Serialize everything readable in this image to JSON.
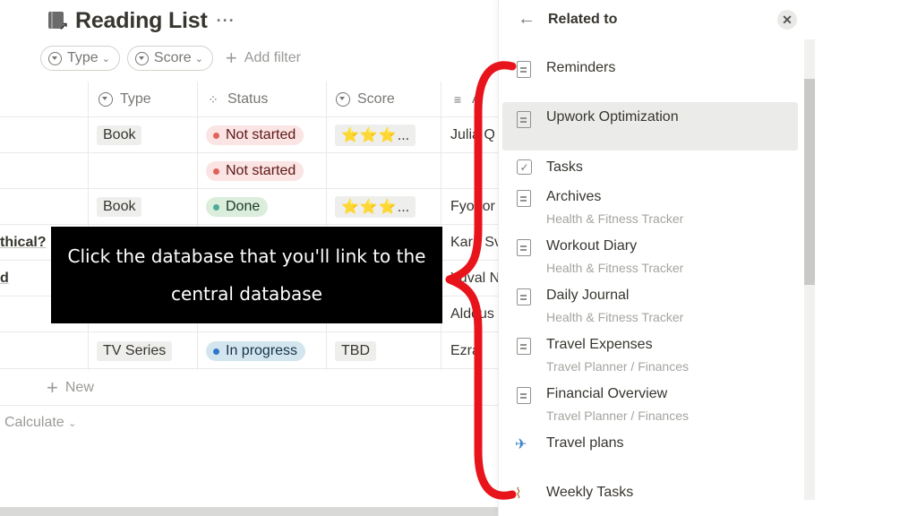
{
  "database": {
    "title": "Reading List",
    "more_label": "···",
    "filters": [
      {
        "label": "Type"
      },
      {
        "label": "Score"
      }
    ],
    "add_filter_label": "Add filter",
    "columns": [
      {
        "label": "Type",
        "icon": "select-icon"
      },
      {
        "label": "Status",
        "icon": "status-icon"
      },
      {
        "label": "Score",
        "icon": "select-icon"
      },
      {
        "label": "A",
        "icon": "text-icon"
      }
    ],
    "rows": [
      {
        "name": "",
        "type": "Book",
        "status": "Not started",
        "status_color": "red",
        "score": "⭐⭐⭐",
        "author": "Julia Q"
      },
      {
        "name": "",
        "type": "",
        "status": "Not started",
        "status_color": "red",
        "score": "",
        "author": ""
      },
      {
        "name": "",
        "type": "Book",
        "status": "Done",
        "status_color": "green",
        "score": "⭐⭐⭐",
        "author": "Fyodor"
      },
      {
        "name": "thical?",
        "type": "",
        "status": "",
        "status_color": "",
        "score": "",
        "author": "Kara Sv"
      },
      {
        "name": "d",
        "type": "",
        "status": "",
        "status_color": "",
        "score": "",
        "author": "Yuval N"
      },
      {
        "name": "",
        "type": "",
        "status": "",
        "status_color": "",
        "score": "",
        "author": "Aldous"
      },
      {
        "name": "",
        "type": "TV Series",
        "status": "In progress",
        "status_color": "blue",
        "score": "TBD",
        "author": "Ezra"
      }
    ],
    "score_ellipsis": "...",
    "new_label": "New",
    "calculate_label": "Calculate"
  },
  "overlay": {
    "line1": "Click the database that you'll link to the",
    "line2": "central database"
  },
  "panel": {
    "title": "Related to",
    "items": [
      {
        "name": "Reminders",
        "sub": "",
        "icon": "page-icon"
      },
      {
        "name": "Upwork Optimization",
        "sub": "",
        "icon": "page-icon",
        "selected": true
      },
      {
        "name": "Tasks",
        "sub": "",
        "icon": "checkbox-icon"
      },
      {
        "name": "Archives",
        "sub": "Health & Fitness Tracker",
        "icon": "page-icon"
      },
      {
        "name": "Workout Diary",
        "sub": "Health & Fitness Tracker",
        "icon": "page-icon"
      },
      {
        "name": "Daily Journal",
        "sub": "Health & Fitness Tracker",
        "icon": "page-icon"
      },
      {
        "name": "Travel Expenses",
        "sub": "Travel Planner / Finances",
        "icon": "page-icon"
      },
      {
        "name": "Financial Overview",
        "sub": "Travel Planner / Finances",
        "icon": "page-icon"
      },
      {
        "name": "Travel plans",
        "sub": "",
        "icon": "airplane-icon"
      },
      {
        "name": "Weekly Tasks",
        "sub": "",
        "icon": "broom-icon"
      }
    ]
  },
  "colors": {
    "brace": "#e8141b",
    "overlay_bg": "#000000"
  }
}
